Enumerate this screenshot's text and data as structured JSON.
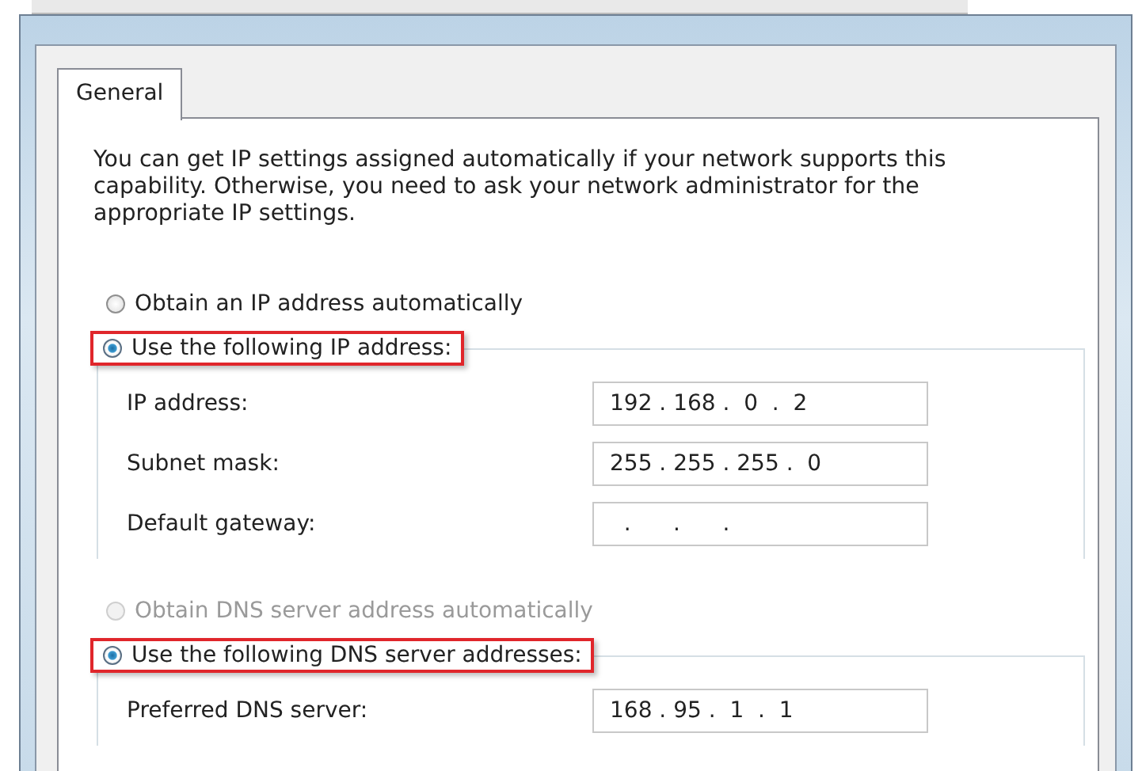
{
  "tabs": [
    {
      "label": "General",
      "selected": true
    }
  ],
  "description": "You can get IP settings assigned automatically if your network supports this capability. Otherwise, you need to ask your network administrator for the appropriate IP settings.",
  "sections": [
    {
      "options": [
        {
          "label": "Obtain an IP address automatically",
          "selected": false,
          "disabled": false,
          "highlighted": false
        },
        {
          "label": "Use the following IP address:",
          "selected": true,
          "disabled": false,
          "highlighted": true
        }
      ],
      "fields": [
        {
          "label": "IP address:",
          "value": "192 . 168 .  0  .  2"
        },
        {
          "label": "Subnet mask:",
          "value": "255 . 255 . 255 .  0"
        },
        {
          "label": "Default gateway:",
          "value": "  .      .      .  "
        }
      ]
    },
    {
      "options": [
        {
          "label": "Obtain DNS server address automatically",
          "selected": false,
          "disabled": true,
          "highlighted": false
        },
        {
          "label": "Use the following DNS server addresses:",
          "selected": true,
          "disabled": false,
          "highlighted": true
        }
      ],
      "fields": [
        {
          "label": "Preferred DNS server:",
          "value": "168 . 95 .  1  .  1"
        }
      ]
    }
  ]
}
